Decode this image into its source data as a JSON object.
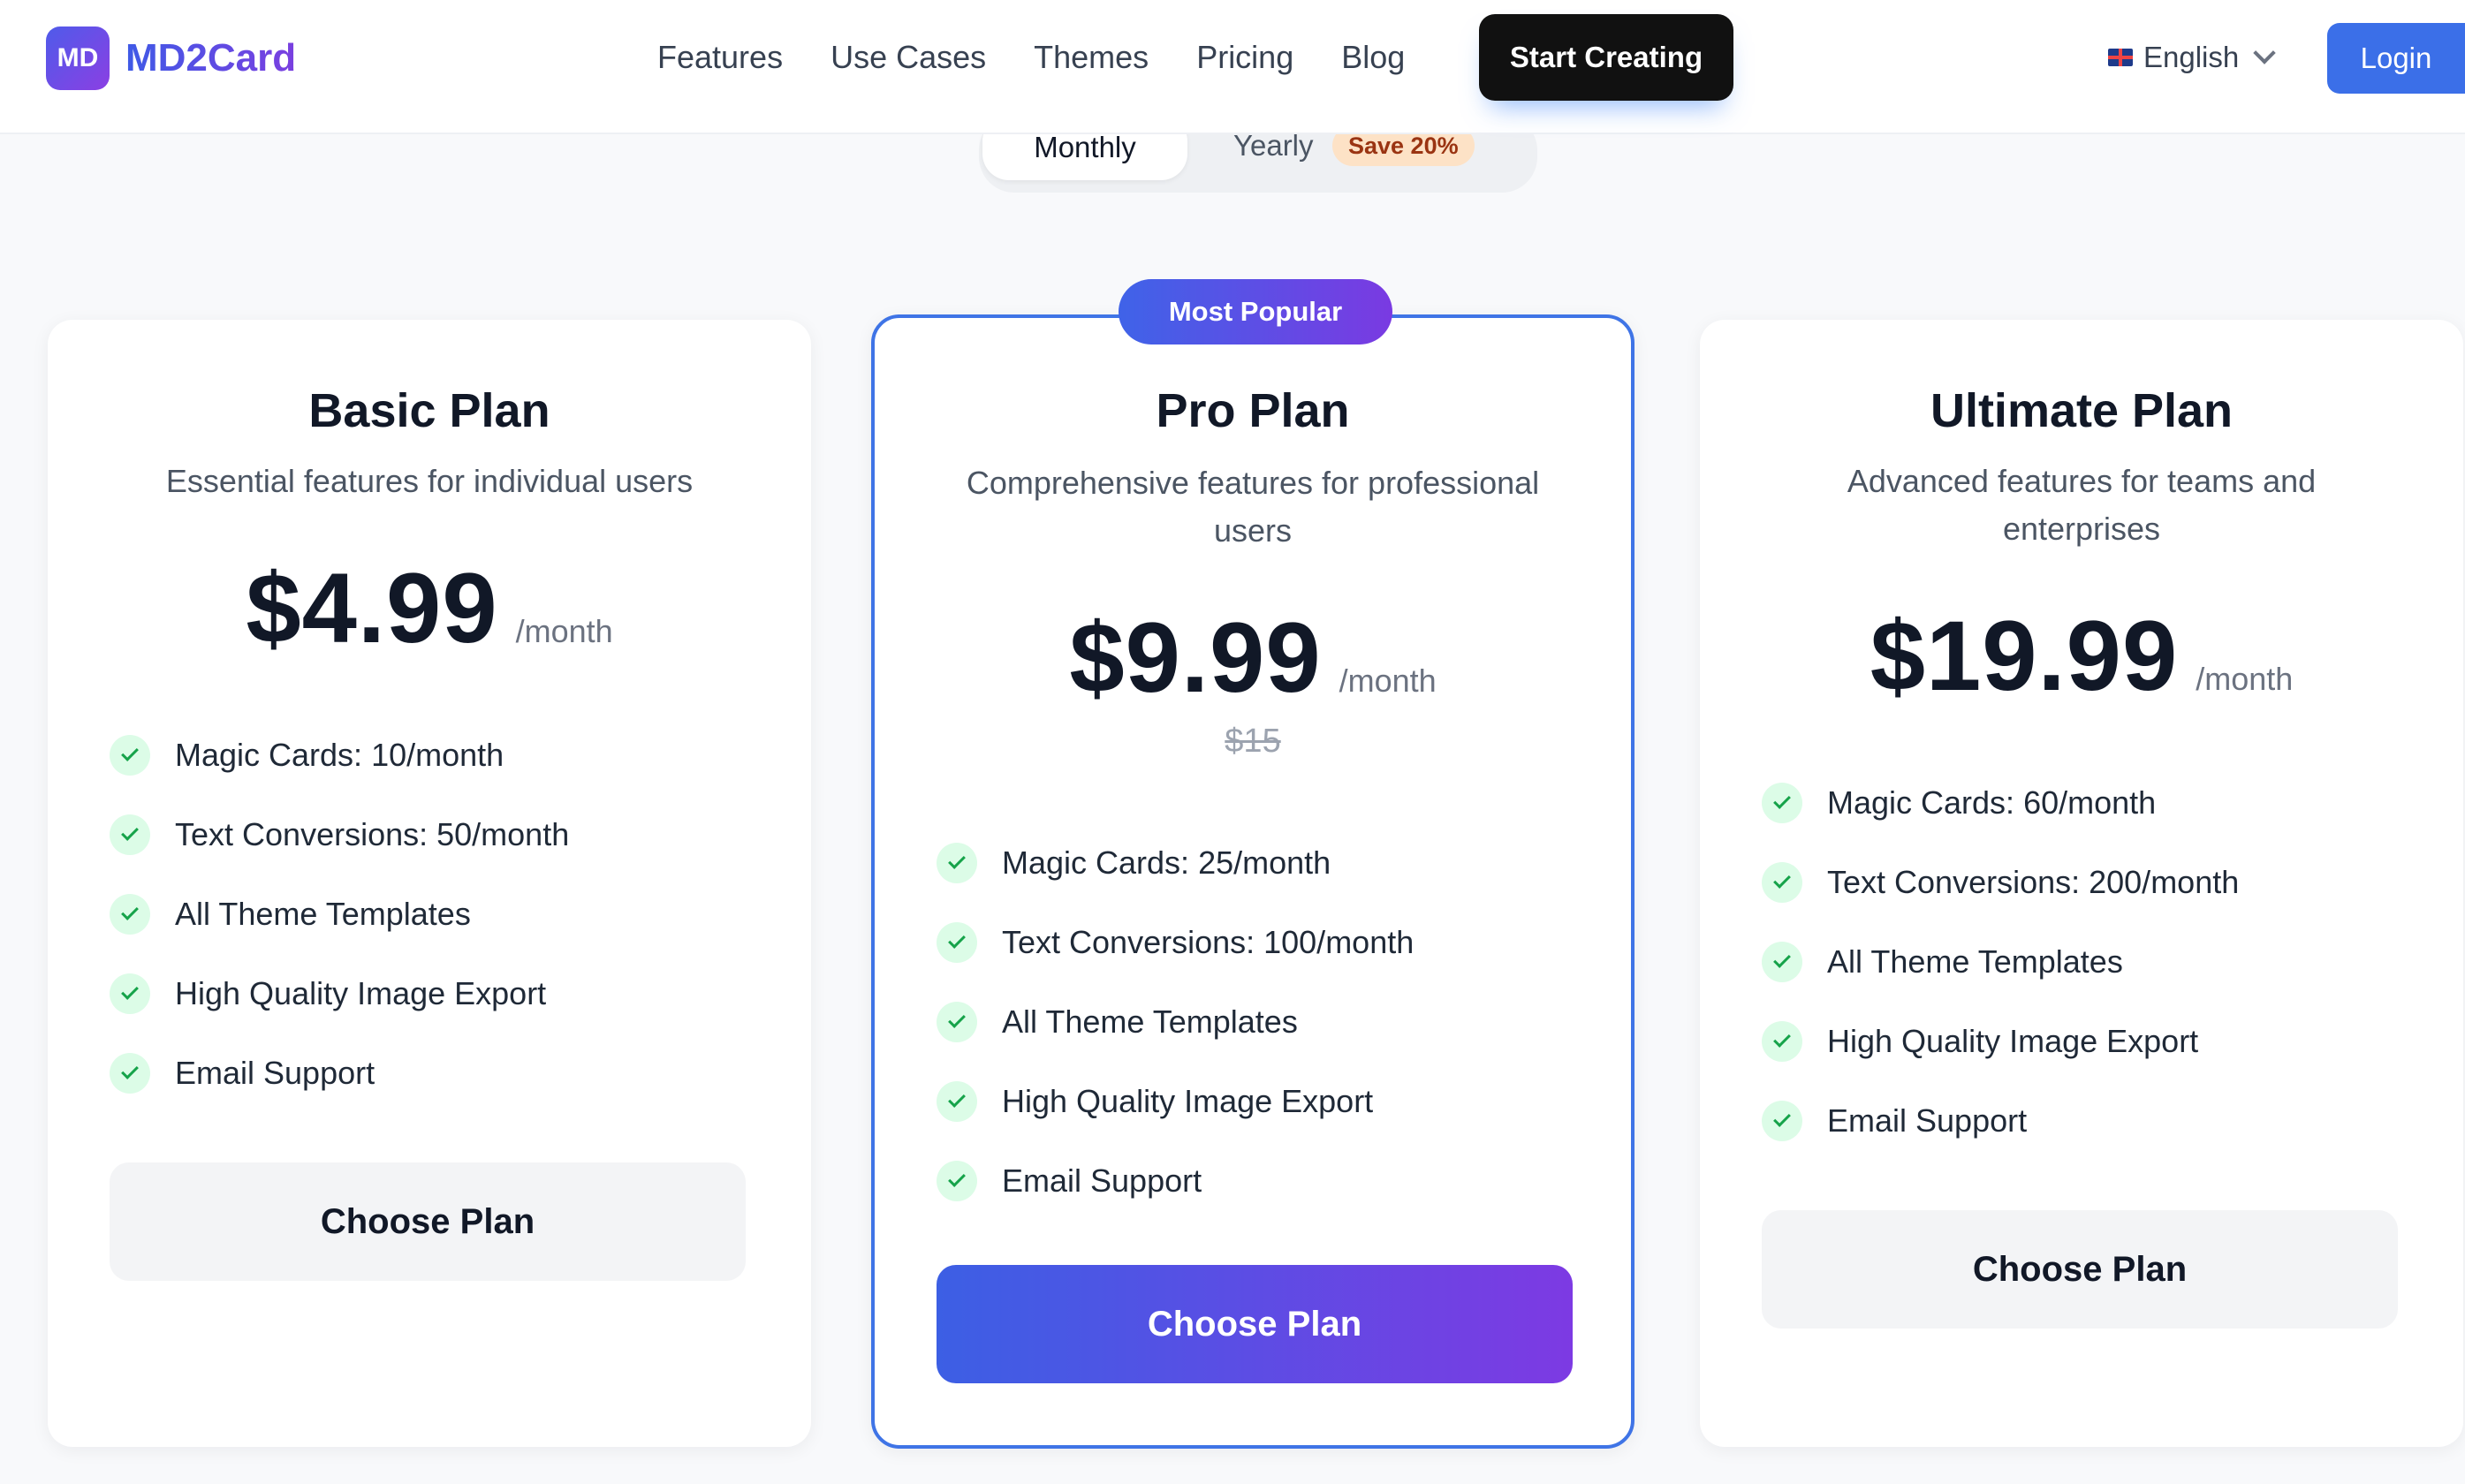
{
  "header": {
    "brand_logo": "MD",
    "brand_name": "MD2Card",
    "nav": [
      "Features",
      "Use Cases",
      "Themes",
      "Pricing",
      "Blog"
    ],
    "cta": "Start Creating",
    "language": "English",
    "login": "Login"
  },
  "billing": {
    "monthly": "Monthly",
    "yearly": "Yearly",
    "save_badge": "Save 20%",
    "selected": "Monthly"
  },
  "plans": [
    {
      "name": "Basic Plan",
      "description": "Essential features for individual users",
      "price": "$4.99",
      "period": "/month",
      "features": [
        "Magic Cards: 10/month",
        "Text Conversions: 50/month",
        "All Theme Templates",
        "High Quality Image Export",
        "Email Support"
      ],
      "button": "Choose Plan"
    },
    {
      "badge": "Most Popular",
      "name": "Pro Plan",
      "description": "Comprehensive features for professional users",
      "price": "$9.99",
      "period": "/month",
      "original_price": "$15",
      "features": [
        "Magic Cards: 25/month",
        "Text Conversions: 100/month",
        "All Theme Templates",
        "High Quality Image Export",
        "Email Support"
      ],
      "button": "Choose Plan"
    },
    {
      "name": "Ultimate Plan",
      "description": "Advanced features for teams and enterprises",
      "price": "$19.99",
      "period": "/month",
      "features": [
        "Magic Cards: 60/month",
        "Text Conversions: 200/month",
        "All Theme Templates",
        "High Quality Image Export",
        "Email Support"
      ],
      "button": "Choose Plan"
    }
  ],
  "colors": {
    "accent": "#3b6fe8",
    "gradient_start": "#3f63e8",
    "gradient_end": "#7a3ae2",
    "check_green": "#16a34a"
  }
}
